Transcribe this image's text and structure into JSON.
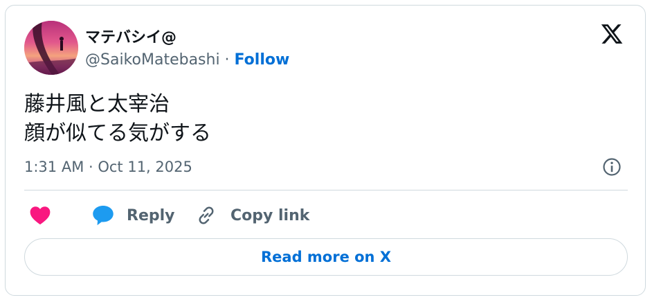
{
  "author": {
    "display_name": "マテバシイ@",
    "handle": "@SaikoMatebashi",
    "separator": " · ",
    "follow_label": "Follow"
  },
  "tweet": {
    "lines": [
      "藤井風と太宰治",
      "顔が似てる気がする"
    ],
    "timestamp": "1:31 AM · Oct 11, 2025"
  },
  "actions": {
    "like_icon": "heart-icon",
    "reply_label": "Reply",
    "reply_icon": "speech-bubble-icon",
    "copy_label": "Copy link",
    "copy_icon": "link-icon"
  },
  "read_more_label": "Read more on X",
  "colors": {
    "accent": "#006fd6",
    "heart": "#f91880",
    "reply": "#1d9bf0",
    "muted": "#536471",
    "text": "#0f1419",
    "border": "#cfd9de"
  }
}
